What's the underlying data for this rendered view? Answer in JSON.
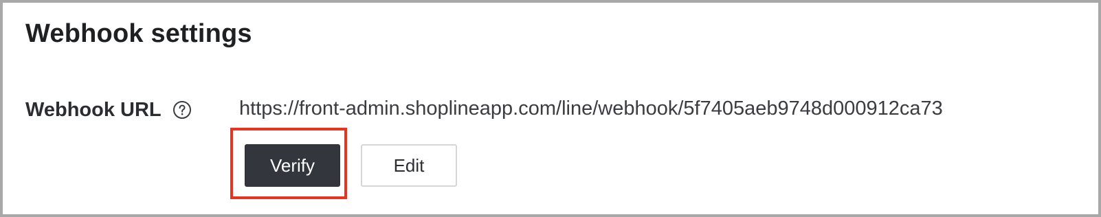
{
  "section": {
    "title": "Webhook settings"
  },
  "webhook_url": {
    "label": "Webhook URL",
    "help_icon": "question-circle-icon",
    "value": "https://front-admin.shoplineapp.com/line/webhook/5f7405aeb9748d000912ca73"
  },
  "actions": {
    "verify_label": "Verify",
    "edit_label": "Edit"
  },
  "colors": {
    "primary_button_bg": "#33373d",
    "highlight_border": "#e8341f",
    "frame_border": "#a8a8a8"
  }
}
